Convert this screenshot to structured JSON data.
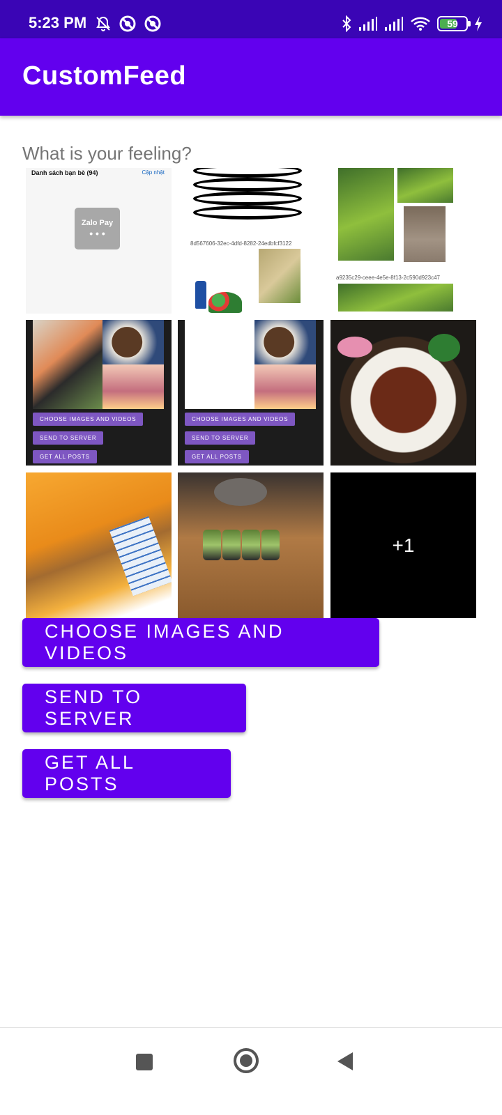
{
  "status_bar": {
    "time": "5:23 PM",
    "battery_level": "59",
    "icons_left": [
      "notifications-off-icon",
      "app-badge-icon",
      "app-badge-icon"
    ],
    "icons_right": [
      "bluetooth-icon",
      "signal-icon",
      "signal-icon",
      "wifi-icon",
      "battery-icon",
      "charging-icon"
    ]
  },
  "app_bar": {
    "title": "CustomFeed"
  },
  "feeling": {
    "placeholder": "What is your feeling?",
    "value": ""
  },
  "media_grid": {
    "cell1": {
      "header": "Danh sách bạn bè (94)",
      "update": "Cập nhật",
      "logo": "Zalo Pay"
    },
    "cell2": {
      "uuid": "8d567606-32ec-4dfd-8282-24edbfcf3122"
    },
    "cell3": {
      "uuid": "a9235c29-ceee-4e5e-8f13-2c590d923c47"
    },
    "mini_buttons": [
      "CHOOSE IMAGES AND VIDEOS",
      "SEND TO SERVER",
      "GET ALL POSTS"
    ],
    "more_count": "+1"
  },
  "actions": {
    "choose": "CHOOSE IMAGES AND VIDEOS",
    "send": "SEND TO SERVER",
    "get_all": "GET ALL POSTS"
  },
  "colors": {
    "primary": "#6200ee",
    "status_bar": "#3a05b5"
  },
  "nav_bar": {
    "icons": [
      "recents-square-icon",
      "home-circle-icon",
      "back-triangle-icon"
    ]
  }
}
